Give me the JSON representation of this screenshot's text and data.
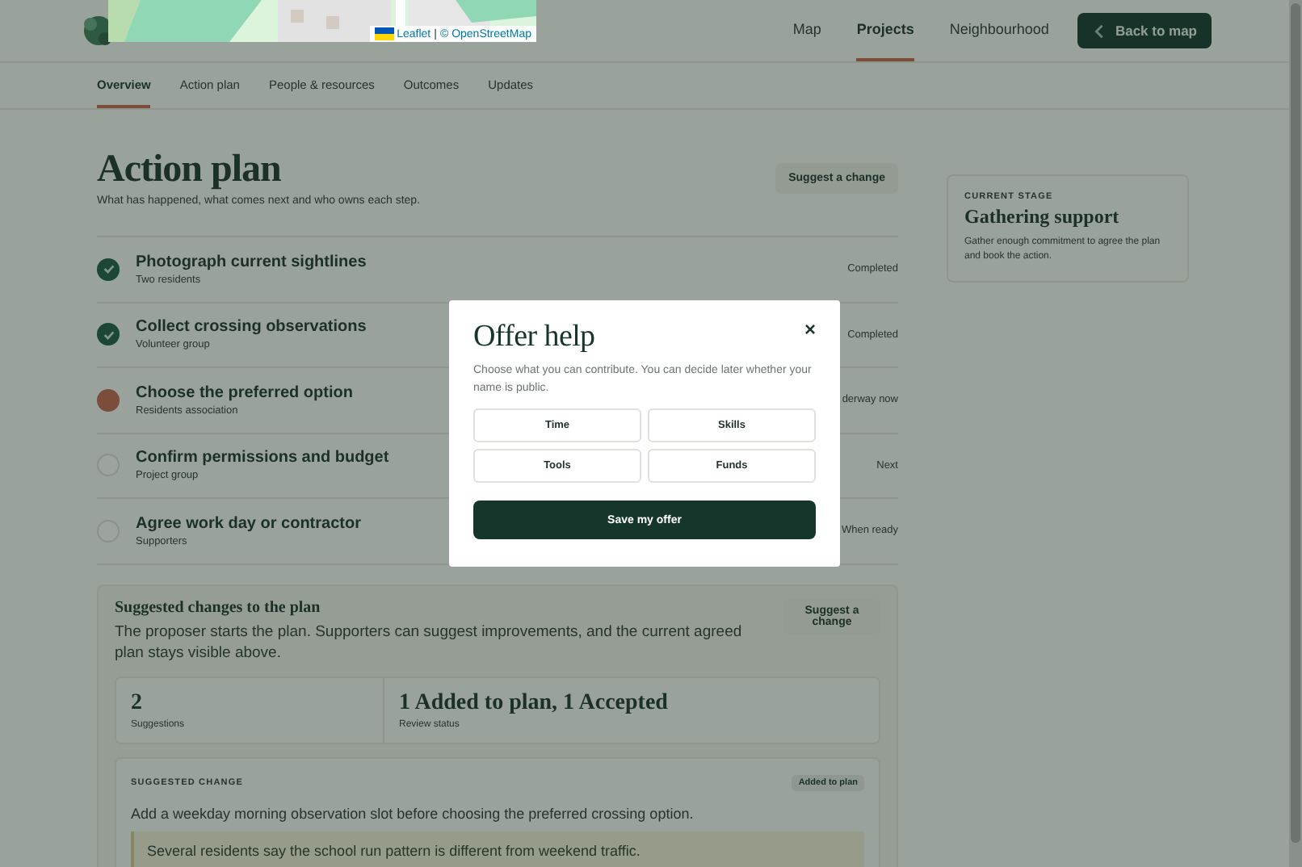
{
  "map": {
    "attribution": {
      "leaflet": "Leaflet",
      "separator": "|",
      "osm": "© OpenStreetMap"
    }
  },
  "nav": [
    {
      "label": "Map",
      "selected": false
    },
    {
      "label": "Projects",
      "selected": true
    },
    {
      "label": "Neighbourhood",
      "selected": false
    }
  ],
  "back_button": "Back to map",
  "tabs": [
    {
      "label": "Overview",
      "selected": true
    },
    {
      "label": "Action plan",
      "selected": false
    },
    {
      "label": "People & resources",
      "selected": false
    },
    {
      "label": "Outcomes",
      "selected": false
    },
    {
      "label": "Updates",
      "selected": false
    }
  ],
  "action_plan": {
    "title": "Action plan",
    "subtitle": "What has happened, what comes next and who owns each step.",
    "button": "Suggest a change",
    "steps": [
      {
        "kind": "done",
        "title": "Photograph current sightlines",
        "owner": "Two residents",
        "status": "Completed"
      },
      {
        "kind": "done",
        "title": "Collect crossing observations",
        "owner": "Volunteer group",
        "status": "Completed"
      },
      {
        "kind": "current",
        "title": "Choose the preferred option",
        "owner": "Residents association",
        "status": "derway now"
      },
      {
        "kind": "pending",
        "title": "Confirm permissions and budget",
        "owner": "Project group",
        "status": "Next"
      },
      {
        "kind": "pending",
        "title": "Agree work day or contractor",
        "owner": "Supporters",
        "status": "When ready"
      }
    ]
  },
  "stage_card": {
    "label": "CURRENT STAGE",
    "title": "Gathering support",
    "text": "Gather enough commitment to agree the plan and book the action."
  },
  "suggestions": {
    "title": "Suggested changes to the plan",
    "text": "The proposer starts the plan. Supporters can suggest improvements, and the current agreed plan stays visible above.",
    "button": "Suggest a change",
    "stats": [
      {
        "value": "2",
        "label": "Suggestions"
      },
      {
        "value": "1 Added to plan, 1 Accepted",
        "label": "Review status"
      }
    ],
    "change": {
      "label": "SUGGESTED CHANGE",
      "badge": "Added to plan",
      "text": "Add a weekday morning observation slot before choosing the preferred crossing option.",
      "note": "Several residents say the school run pattern is different from weekend traffic."
    }
  },
  "modal": {
    "title": "Offer help",
    "close": "×",
    "text": "Choose what you can contribute. You can decide later whether your name is public.",
    "options": [
      {
        "label": "Time",
        "selected": false
      },
      {
        "label": "Skills",
        "selected": false
      },
      {
        "label": "Tools",
        "selected": false
      },
      {
        "label": "Funds",
        "selected": false
      }
    ],
    "submit": "Save my offer"
  }
}
